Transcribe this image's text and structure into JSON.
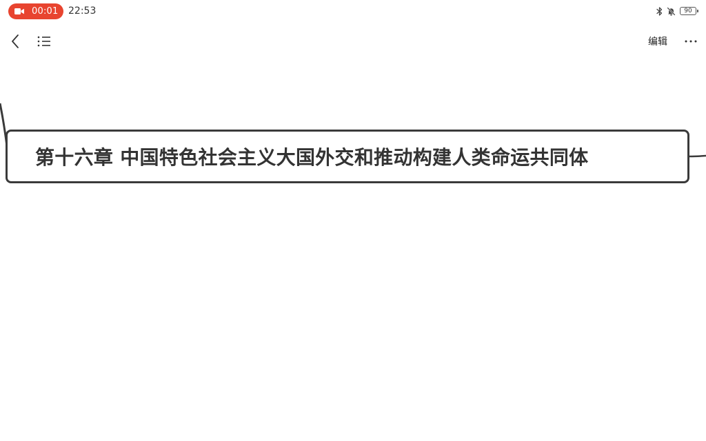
{
  "status_bar": {
    "recording_time": "00:01",
    "clock": "22:53",
    "battery_level": "90",
    "recording_color": "#e8442f",
    "icons": [
      "video-camera-icon",
      "bluetooth-icon",
      "mute-bell-icon",
      "battery-icon"
    ]
  },
  "toolbar": {
    "edit_label": "编辑",
    "more_label": "···",
    "icons": [
      "back-arrow-icon",
      "outline-list-icon",
      "more-dots-icon"
    ]
  },
  "mind_map": {
    "topic": "第十六章  中国特色社会主义大国外交和推动构建人类命运共同体",
    "node_border_color": "#3a3a3a",
    "text_color": "#333333"
  }
}
